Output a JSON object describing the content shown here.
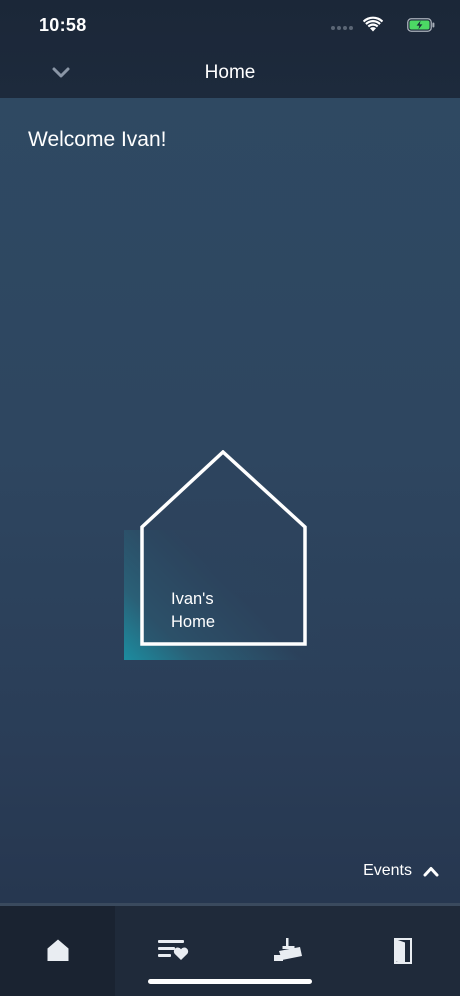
{
  "status_bar": {
    "time": "10:58"
  },
  "header": {
    "title": "Home"
  },
  "welcome_text": "Welcome Ivan!",
  "home_tile": {
    "label": "Ivan's\nHome"
  },
  "events": {
    "label": "Events"
  },
  "tabs": [
    {
      "icon": "home-icon",
      "active": true
    },
    {
      "icon": "favorites-list-icon",
      "active": false
    },
    {
      "icon": "security-camera-icon",
      "active": false
    },
    {
      "icon": "door-icon",
      "active": false
    }
  ],
  "colors": {
    "accent_teal": "#1c8c9f",
    "battery_green": "#4cd964"
  }
}
